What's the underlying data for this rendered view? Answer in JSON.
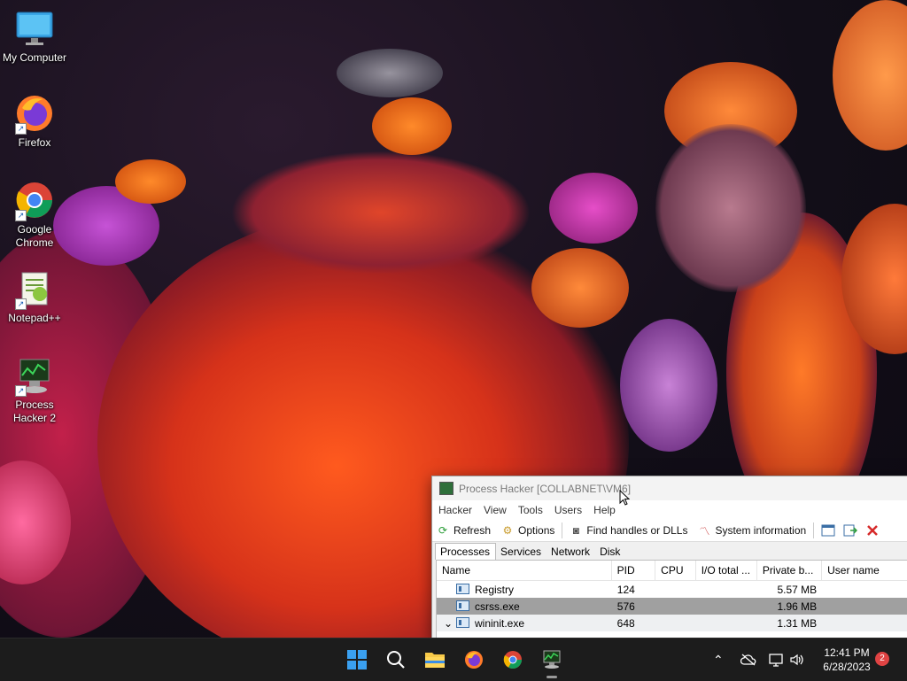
{
  "desktop": {
    "icons": [
      {
        "label": "My Computer",
        "icon": "monitor-icon"
      },
      {
        "label": "Firefox",
        "icon": "firefox-icon"
      },
      {
        "label": "Google Chrome",
        "icon": "chrome-icon"
      },
      {
        "label": "Notepad++",
        "icon": "notepad-plus-plus-icon"
      },
      {
        "label": "Process Hacker 2",
        "icon": "process-hacker-icon"
      }
    ]
  },
  "window": {
    "title": "Process Hacker [COLLABNET\\VM6]",
    "menu": [
      "Hacker",
      "View",
      "Tools",
      "Users",
      "Help"
    ],
    "toolbar": {
      "refresh": "Refresh",
      "options": "Options",
      "find": "Find handles or DLLs",
      "sysinfo": "System information"
    },
    "tabs": [
      "Processes",
      "Services",
      "Network",
      "Disk"
    ],
    "columns": [
      "Name",
      "PID",
      "CPU",
      "I/O total ...",
      "Private b...",
      "User name"
    ],
    "rows": [
      {
        "name": "Registry",
        "pid": "124",
        "cpu": "",
        "io": "",
        "priv": "5.57 MB",
        "user": ""
      },
      {
        "name": "csrss.exe",
        "pid": "576",
        "cpu": "",
        "io": "",
        "priv": "1.96 MB",
        "user": ""
      },
      {
        "name": "wininit.exe",
        "pid": "648",
        "cpu": "",
        "io": "",
        "priv": "1.31 MB",
        "user": ""
      }
    ]
  },
  "taskbar": {
    "time": "12:41 PM",
    "date": "6/28/2023",
    "notifications": "2"
  },
  "colors": {
    "taskbar_bg": "#1c1c1c",
    "selected_row": "#a0a0a0",
    "accent_blue": "#0078d4"
  }
}
